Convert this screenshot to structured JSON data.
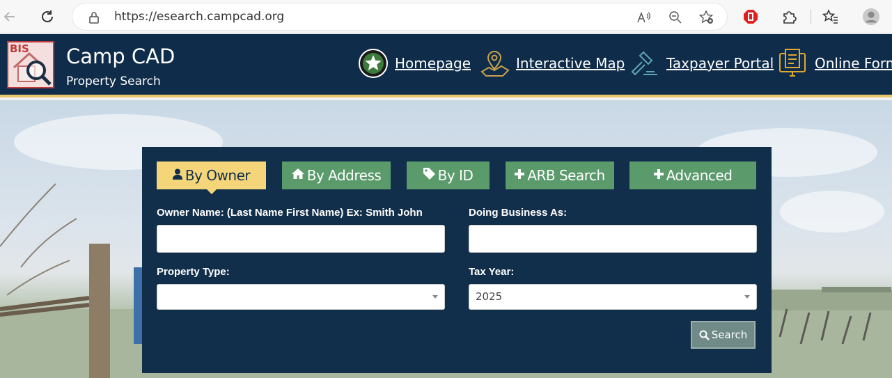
{
  "browser": {
    "url": "https://esearch.campcad.org"
  },
  "site": {
    "logo_text": "BIS",
    "title": "Camp CAD",
    "subtitle": "Property Search",
    "nav": [
      {
        "label": "Homepage",
        "icon": "seal-star-icon"
      },
      {
        "label": "Interactive Map",
        "icon": "map-pin-icon"
      },
      {
        "label": "Taxpayer Portal",
        "icon": "gavel-icon"
      },
      {
        "label": "Online Forms",
        "icon": "form-monitor-icon"
      }
    ]
  },
  "search": {
    "tabs": [
      {
        "label": "By Owner",
        "icon": "user-icon",
        "active": true
      },
      {
        "label": "By Address",
        "icon": "home-icon",
        "active": false
      },
      {
        "label": "By ID",
        "icon": "tag-icon",
        "active": false
      },
      {
        "label": "ARB Search",
        "icon": "plus-icon",
        "active": false
      },
      {
        "label": "Advanced",
        "icon": "plus-icon",
        "active": false
      }
    ],
    "owner_name_label": "Owner Name: (Last Name First Name) Ex: Smith John",
    "owner_name_value": "",
    "dba_label": "Doing Business As:",
    "dba_value": "",
    "property_type_label": "Property Type:",
    "property_type_value": "",
    "tax_year_label": "Tax Year:",
    "tax_year_value": "2025",
    "search_button": "Search"
  },
  "colors": {
    "header_bg": "#0f2d4a",
    "accent_gold": "#e8c46a",
    "tab_green": "#5a9a6b",
    "tab_active": "#f5d57a"
  }
}
